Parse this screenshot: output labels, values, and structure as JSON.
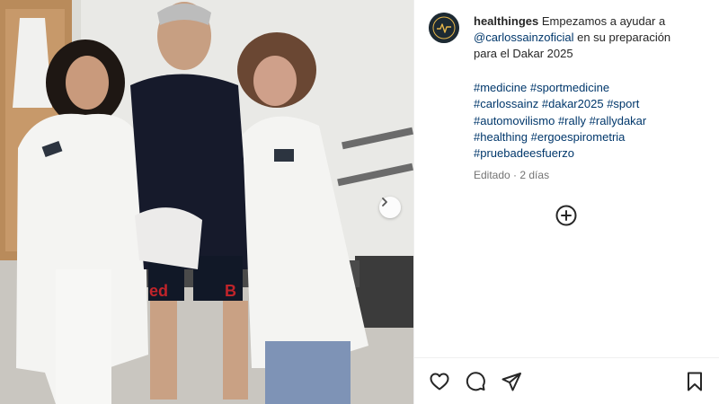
{
  "post": {
    "username": "healthinges",
    "caption_lines": [
      "Empezamos a ayudar a",
      "@carlossainzoficial",
      "en su preparación",
      "para el Dakar 2025"
    ],
    "hashtag_lines": [
      [
        "#medicine",
        "#sportmedicine"
      ],
      [
        "#carlossainz",
        "#dakar2025",
        "#sport"
      ],
      [
        "#automovilismo",
        "#rally",
        "#rallydakar"
      ],
      [
        "#healthing",
        "#ergoespirometria"
      ],
      [
        "#pruebadeesfuerzo"
      ]
    ],
    "edited_label": "Editado",
    "separator": " · ",
    "time_ago": "2 días"
  },
  "icons": {
    "next": "chevron-right-icon",
    "load_more": "plus-circle-icon",
    "like": "heart-icon",
    "comment": "comment-icon",
    "share": "share-icon",
    "save": "bookmark-icon"
  },
  "colors": {
    "link": "#00376b",
    "text": "#262626",
    "muted": "#737373"
  }
}
